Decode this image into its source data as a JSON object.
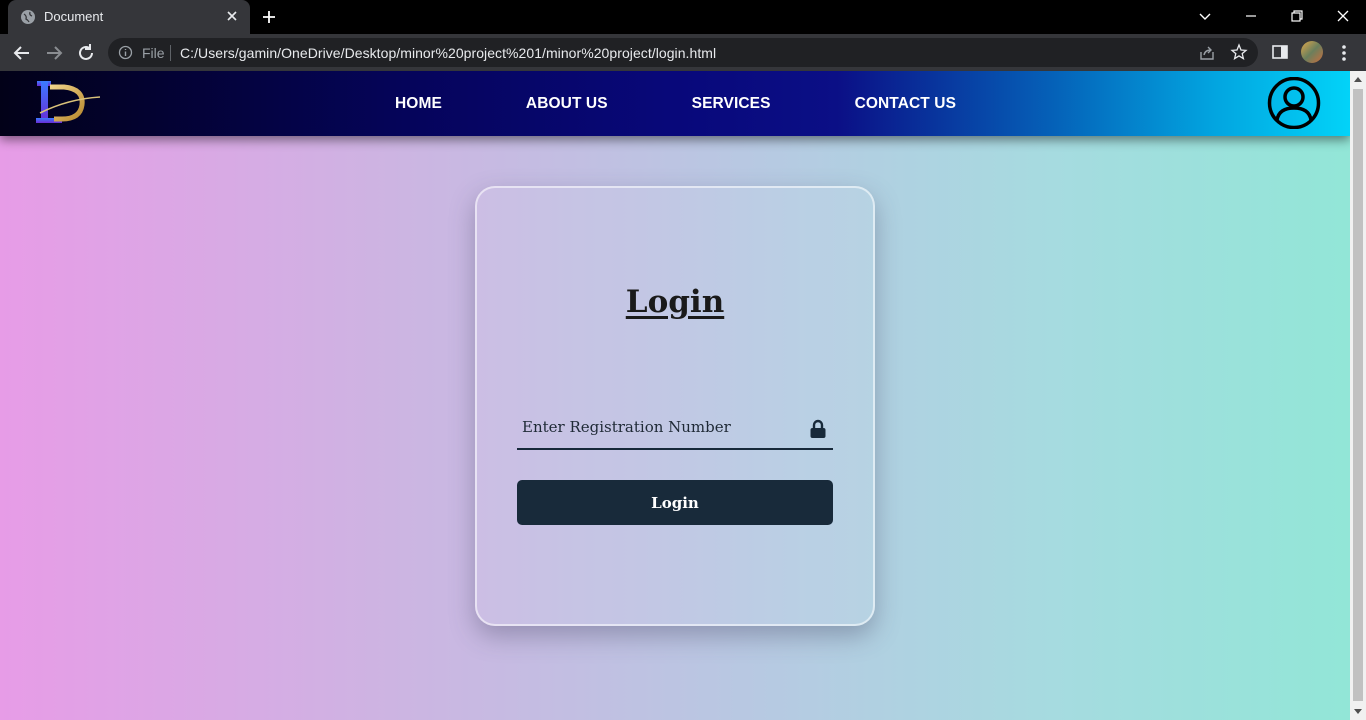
{
  "browser": {
    "tab_title": "Document",
    "url_scheme_label": "File",
    "url": "C:/Users/gamin/OneDrive/Desktop/minor%20project%201/minor%20project/login.html"
  },
  "nav": {
    "items": [
      {
        "label": "HOME"
      },
      {
        "label": "ABOUT US"
      },
      {
        "label": "SERVICES"
      },
      {
        "label": "CONTACT US"
      }
    ]
  },
  "login": {
    "title": "Login",
    "reg_placeholder": "Enter Registration Number",
    "button_label": "Login"
  },
  "icons": {
    "favicon": "globe-icon",
    "lock": "lock-icon",
    "user": "user-circle-icon"
  },
  "colors": {
    "button_bg": "#182a3a",
    "nav_start": "#020118",
    "nav_end": "#02d3f8"
  }
}
